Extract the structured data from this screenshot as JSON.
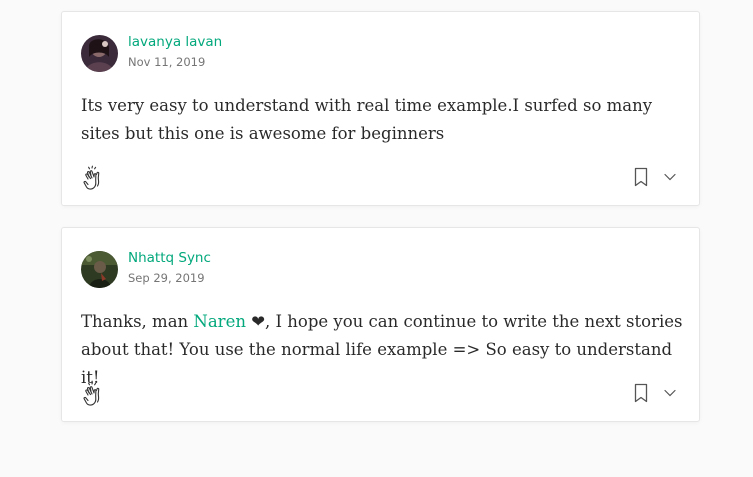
{
  "responses": [
    {
      "author": "lavanya lavan",
      "date": "Nov 11, 2019",
      "text": "Its very easy to understand with real time example.I surfed so many sites but this one is awesome for beginners"
    },
    {
      "author": "Nhattq Sync",
      "date": "Sep 29, 2019",
      "text_before": "Thanks, man ",
      "mention": "Naren",
      "text_after": " ❤︎, I hope you can continue to write the next stories about that! You use the normal life example => So easy to understand it!"
    }
  ],
  "icons": {
    "clap": "clap-icon",
    "bookmark": "bookmark-icon",
    "more": "chevron-down-icon"
  },
  "colors": {
    "accent": "#03a87c",
    "text": "#292929",
    "muted": "#757575"
  }
}
